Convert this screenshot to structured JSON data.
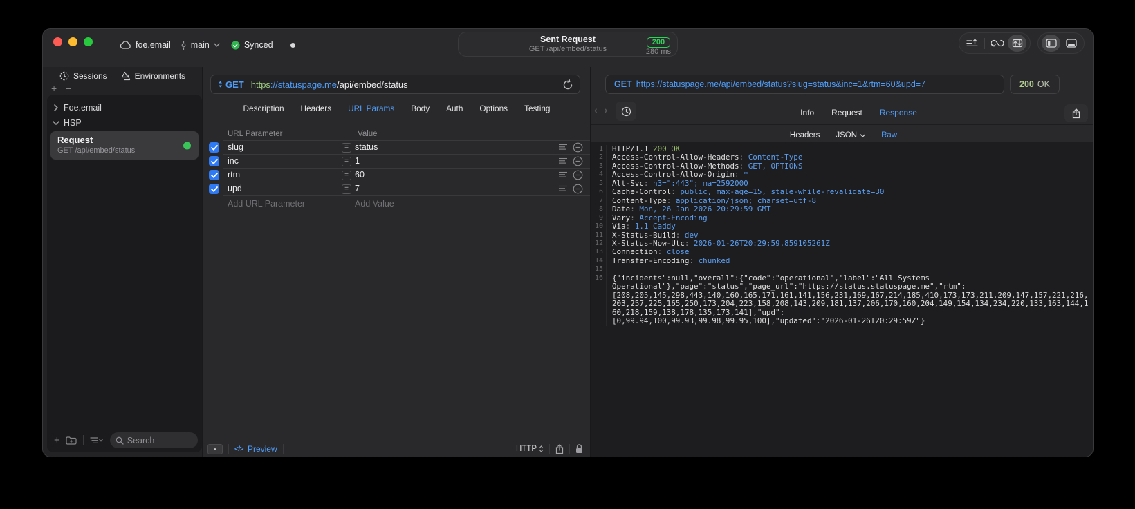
{
  "titlebar": {
    "project": "foe.email",
    "branch": "main",
    "sync_label": "Synced",
    "center": {
      "title": "Sent Request",
      "subtitle": "GET /api/embed/status",
      "status_code": "200",
      "duration": "280 ms"
    }
  },
  "sidebar": {
    "tabs": [
      {
        "label": "Sessions"
      },
      {
        "label": "Environments"
      }
    ],
    "tree_items": [
      {
        "label": "Foe.email",
        "state": "collapsed"
      },
      {
        "label": "HSP",
        "state": "expanded"
      }
    ],
    "request_item": {
      "title": "Request",
      "subtitle": "GET /api/embed/status"
    },
    "search_placeholder": "Search"
  },
  "request_editor": {
    "method": "GET",
    "url": {
      "scheme": "https",
      "host": "://statuspage.me",
      "path": "/api/embed/status"
    },
    "tabs": [
      "Description",
      "Headers",
      "URL Params",
      "Body",
      "Auth",
      "Options",
      "Testing"
    ],
    "active_tab": "URL Params",
    "params_table": {
      "columns": [
        "URL Parameter",
        "Value"
      ],
      "rows": [
        {
          "enabled": true,
          "name": "slug",
          "value": "status"
        },
        {
          "enabled": true,
          "name": "inc",
          "value": "1"
        },
        {
          "enabled": true,
          "name": "rtm",
          "value": "60"
        },
        {
          "enabled": true,
          "name": "upd",
          "value": "7"
        }
      ],
      "add_row": {
        "name_placeholder": "Add URL Parameter",
        "value_placeholder": "Add Value"
      }
    },
    "footer": {
      "preview_label": "Preview",
      "protocol": "HTTP"
    }
  },
  "response_viewer": {
    "request_line": {
      "method": "GET",
      "url": "https://statuspage.me/api/embed/status?slug=status&inc=1&rtm=60&upd=7"
    },
    "status": {
      "code": "200",
      "text": "OK"
    },
    "tabs": [
      "Info",
      "Request",
      "Response"
    ],
    "active_tab": "Response",
    "subtabs": [
      "Headers",
      "JSON",
      "Raw"
    ],
    "active_subtab": "Raw",
    "body": {
      "status_line": {
        "protocol": "HTTP/1.1 ",
        "status": "200 OK"
      },
      "headers": [
        {
          "name": "Access-Control-Allow-Headers",
          "value": "Content-Type"
        },
        {
          "name": "Access-Control-Allow-Methods",
          "value": "GET, OPTIONS"
        },
        {
          "name": "Access-Control-Allow-Origin",
          "value": "*"
        },
        {
          "name": "Alt-Svc",
          "value": "h3=\":443\"; ma=2592000"
        },
        {
          "name": "Cache-Control",
          "value": "public, max-age=15, stale-while-revalidate=30"
        },
        {
          "name": "Content-Type",
          "value": "application/json; charset=utf-8"
        },
        {
          "name": "Date",
          "value": "Mon, 26 Jan 2026 20:29:59 GMT"
        },
        {
          "name": "Vary",
          "value": "Accept-Encoding"
        },
        {
          "name": "Via",
          "value": "1.1 Caddy"
        },
        {
          "name": "X-Status-Build",
          "value": "dev"
        },
        {
          "name": "X-Status-Now-Utc",
          "value": "2026-01-26T20:29:59.859105261Z"
        },
        {
          "name": "Connection",
          "value": "close"
        },
        {
          "name": "Transfer-Encoding",
          "value": "chunked"
        }
      ],
      "json_wrapped_lines": [
        "{\"incidents\":null,\"overall\":{\"code\":\"operational\",\"label\":\"All Systems",
        "Operational\"},\"page\":\"status\",\"page_url\":\"https://status.statuspage.me\",\"rtm\":",
        "[208,205,145,298,443,140,160,165,171,161,141,156,231,169,167,214,185,410,173,173,211,209,147,157,221,216,",
        "203,257,225,165,250,173,204,223,158,208,143,209,181,137,206,170,160,204,149,154,134,234,220,133,163,144,1",
        "60,218,159,138,178,135,173,141],\"upd\":",
        "[0,99.94,100,99.93,99.98,99.95,100],\"updated\":\"2026-01-26T20:29:59Z\"}"
      ]
    }
  }
}
